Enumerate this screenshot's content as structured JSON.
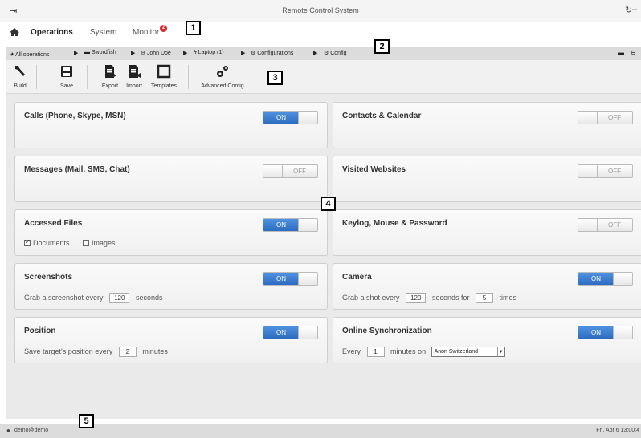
{
  "window": {
    "title": "Remote Control System"
  },
  "menu": {
    "items": [
      {
        "label": "Operations"
      },
      {
        "label": "System"
      },
      {
        "label": "Monitor"
      }
    ],
    "monitor_badge": "2"
  },
  "breadcrumb": {
    "items": [
      {
        "label": "All operations",
        "icon": "globe-icon"
      },
      {
        "label": "Swordfish",
        "icon": "folder-icon"
      },
      {
        "label": "John Doe",
        "icon": "target-icon"
      },
      {
        "label": "Laptop (1)",
        "icon": "lightning-icon"
      },
      {
        "label": "Configurations",
        "icon": "gears-icon"
      },
      {
        "label": "Config",
        "icon": "gears-icon"
      }
    ]
  },
  "toolbar": {
    "build": "Build",
    "save": "Save",
    "export": "Export",
    "import": "Import",
    "templates": "Templates",
    "advanced": "Advanced Config"
  },
  "modules": {
    "calls": {
      "title": "Calls (Phone, Skype, MSN)",
      "state": "ON"
    },
    "contacts": {
      "title": "Contacts & Calendar",
      "state": "OFF"
    },
    "messages": {
      "title": "Messages (Mail, SMS, Chat)",
      "state": "OFF"
    },
    "websites": {
      "title": "Visited Websites",
      "state": "OFF"
    },
    "files": {
      "title": "Accessed Files",
      "state": "ON",
      "opt_documents": "Documents",
      "opt_images": "Images",
      "documents_checked": true,
      "images_checked": false
    },
    "keylog": {
      "title": "Keylog, Mouse & Password",
      "state": "OFF"
    },
    "screenshots": {
      "title": "Screenshots",
      "state": "ON",
      "prefix": "Grab a screenshot every",
      "value": "120",
      "suffix": "seconds"
    },
    "camera": {
      "title": "Camera",
      "state": "ON",
      "prefix": "Grab a shot every",
      "value": "120",
      "middle": "seconds for",
      "times_value": "5",
      "suffix": "times"
    },
    "position": {
      "title": "Position",
      "state": "ON",
      "prefix": "Save target's position every",
      "value": "2",
      "suffix": "minutes"
    },
    "sync": {
      "title": "Online Synchronization",
      "state": "ON",
      "prefix": "Every",
      "value": "1",
      "middle": "minutes on",
      "selected": "Anon Switzerland"
    }
  },
  "callouts": [
    "1",
    "2",
    "3",
    "4",
    "5"
  ],
  "status": {
    "user": "demo@demo",
    "datetime": "Fri, Apr 6  13:00:4"
  },
  "colors": {
    "accent": "#2d6cc0",
    "badge": "#e0242b"
  }
}
